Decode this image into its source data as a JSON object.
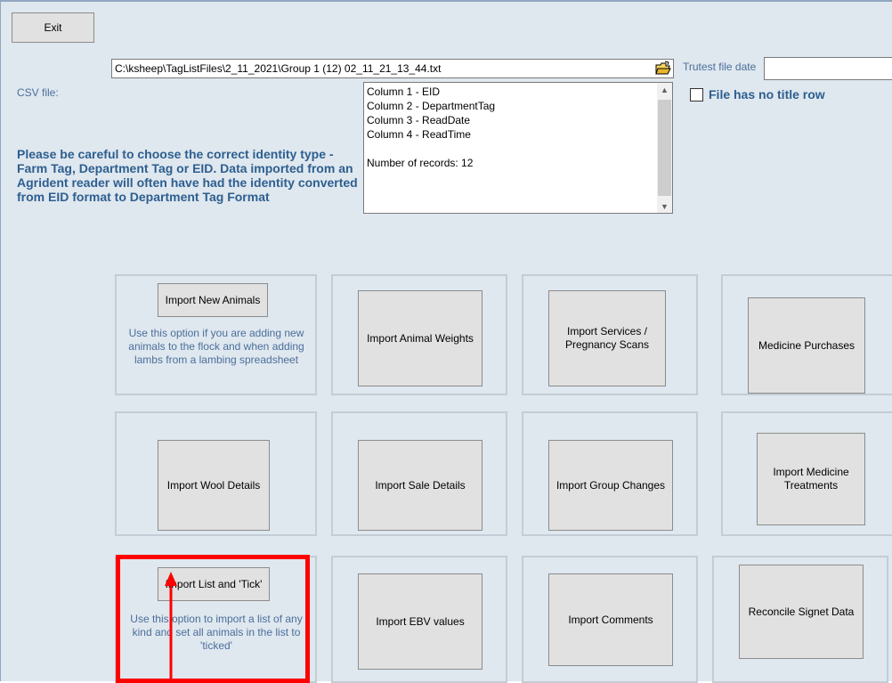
{
  "toolbar": {
    "exit_label": "Exit"
  },
  "file": {
    "path": "C:\\ksheep\\TagListFiles\\2_11_2021\\Group 1 (12) 02_11_21_13_44.txt",
    "csv_label": "CSV file:",
    "trutest_label": "Trutest file date",
    "trutest_value": "",
    "no_title_row_label": "File has no title row",
    "no_title_row_checked": false
  },
  "columns": {
    "lines": [
      "Column 1 -  EID",
      "Column 2 - DepartmentTag",
      "Column 3 - ReadDate",
      "Column 4 - ReadTime",
      "",
      "Number of records: 12"
    ]
  },
  "warning": "Please be careful to choose the correct identity type - Farm Tag, Department Tag or EID.  Data imported from an Agrident reader will often have had the identity converted from EID format to Department Tag Format",
  "panels": {
    "new_animals": {
      "button": "Import New Animals",
      "note": "Use this option if you are adding new animals to the flock and when adding lambs from a lambing spreadsheet"
    },
    "weights": {
      "button": "Import Animal Weights"
    },
    "services": {
      "button": "Import Services / Pregnancy Scans"
    },
    "med_purchases": {
      "button": "Medicine Purchases"
    },
    "wool": {
      "button": "Import Wool Details"
    },
    "sale": {
      "button": "Import Sale Details"
    },
    "group": {
      "button": "Import Group Changes"
    },
    "med_treatments": {
      "button": "Import Medicine Treatments"
    },
    "list_tick": {
      "button": "Import List and 'Tick'",
      "note": "Use this option to import a list of any kind and set all animals in the list to 'ticked'"
    },
    "ebv": {
      "button": "Import EBV values"
    },
    "comments": {
      "button": "Import Comments"
    },
    "signet": {
      "button": "Reconcile Signet Data"
    }
  },
  "annotation": {
    "highlight_color": "#ff0000"
  }
}
